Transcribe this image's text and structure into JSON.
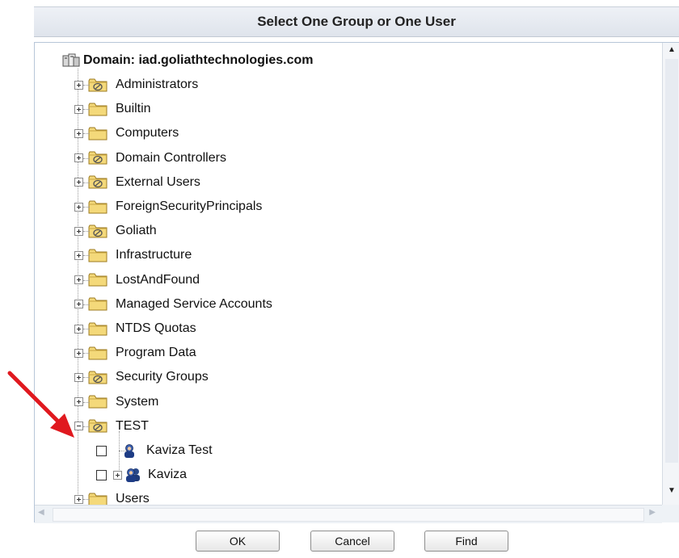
{
  "dialog": {
    "title": "Select One Group or One User",
    "domain_label": "Domain: iad.goliathtechnologies.com",
    "tree": [
      {
        "label": "Administrators",
        "folder": "group"
      },
      {
        "label": "Builtin",
        "folder": "plain"
      },
      {
        "label": "Computers",
        "folder": "plain"
      },
      {
        "label": "Domain Controllers",
        "folder": "group"
      },
      {
        "label": "External Users",
        "folder": "group"
      },
      {
        "label": "ForeignSecurityPrincipals",
        "folder": "plain"
      },
      {
        "label": "Goliath",
        "folder": "group"
      },
      {
        "label": "Infrastructure",
        "folder": "plain"
      },
      {
        "label": "LostAndFound",
        "folder": "plain"
      },
      {
        "label": "Managed Service Accounts",
        "folder": "plain"
      },
      {
        "label": "NTDS Quotas",
        "folder": "plain"
      },
      {
        "label": "Program Data",
        "folder": "plain"
      },
      {
        "label": "Security Groups",
        "folder": "group"
      },
      {
        "label": "System",
        "folder": "plain"
      },
      {
        "label": "TEST",
        "folder": "group",
        "expanded": true,
        "children": [
          {
            "label": "Kaviza Test",
            "type": "user"
          },
          {
            "label": "Kaviza",
            "type": "group"
          }
        ]
      },
      {
        "label": "Users",
        "folder": "plain"
      }
    ],
    "buttons": {
      "ok": "OK",
      "cancel": "Cancel",
      "find": "Find"
    }
  },
  "colors": {
    "annotation_arrow": "#e0191f",
    "folder": "#f4d97a",
    "title_bar": "#e6eaf0"
  }
}
